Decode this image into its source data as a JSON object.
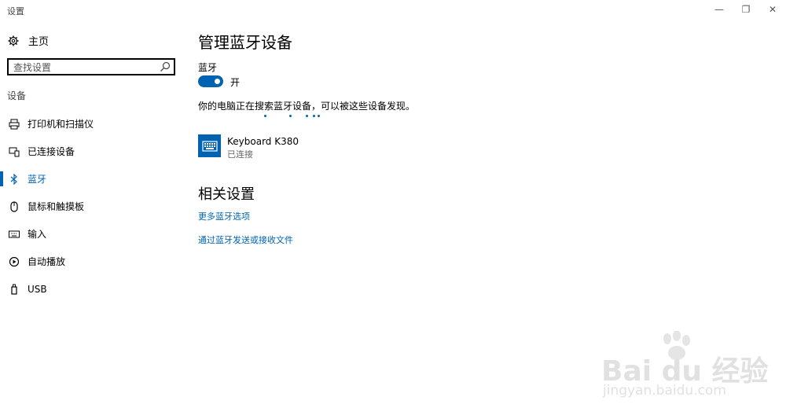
{
  "window": {
    "title": "设置",
    "minimize_glyph": "—",
    "restore_glyph": "❐",
    "close_glyph": "✕"
  },
  "sidebar": {
    "home_label": "主页",
    "search_placeholder": "查找设置",
    "section_label": "设备",
    "items": [
      {
        "label": "打印机和扫描仪",
        "icon": "printer-icon"
      },
      {
        "label": "已连接设备",
        "icon": "connected-devices-icon"
      },
      {
        "label": "蓝牙",
        "icon": "bluetooth-icon",
        "active": true
      },
      {
        "label": "鼠标和触摸板",
        "icon": "mouse-icon"
      },
      {
        "label": "输入",
        "icon": "keyboard-icon"
      },
      {
        "label": "自动播放",
        "icon": "autoplay-icon"
      },
      {
        "label": "USB",
        "icon": "usb-icon"
      }
    ]
  },
  "main": {
    "title": "管理蓝牙设备",
    "bluetooth_label": "蓝牙",
    "toggle_state": "开",
    "toggle_on": true,
    "status_text": "你的电脑正在搜索蓝牙设备，可以被这些设备发现。",
    "device": {
      "name": "Keyboard K380",
      "status": "已连接",
      "icon": "keyboard-icon"
    },
    "related_title": "相关设置",
    "links": [
      "更多蓝牙选项",
      "通过蓝牙发送或接收文件"
    ]
  },
  "watermark": {
    "brand": "Bai du 经验",
    "url": "jingyan.baidu.com"
  },
  "colors": {
    "accent": "#0063b1",
    "text": "#000000",
    "background": "#ffffff"
  }
}
